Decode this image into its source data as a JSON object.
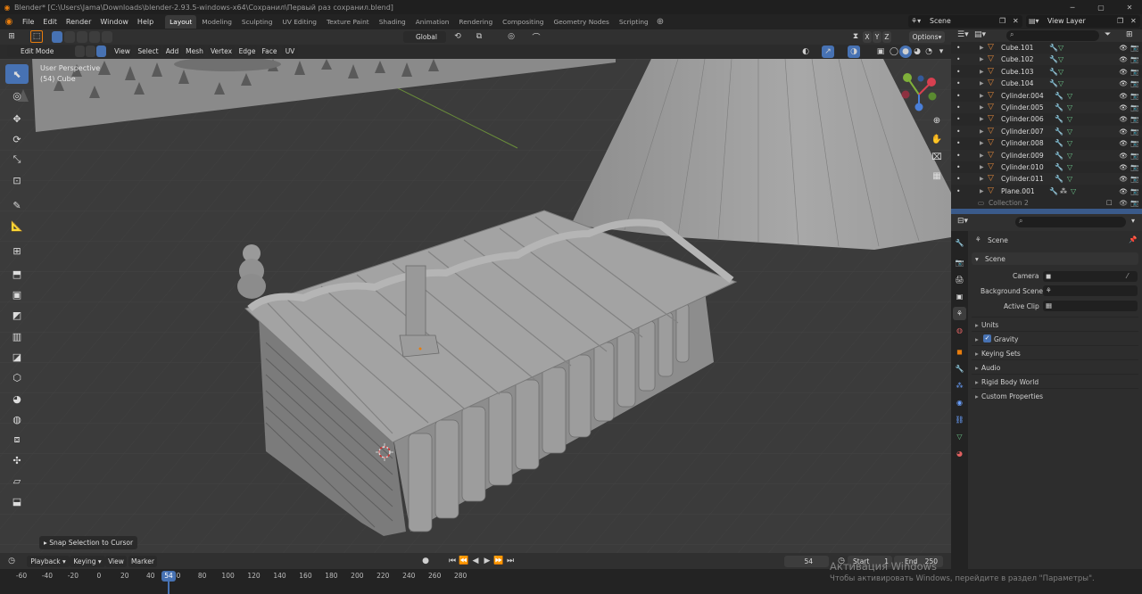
{
  "window": {
    "title": "Blender* [C:\\Users\\Jama\\Downloads\\blender-2.93.5-windows-x64\\Сохранил\\Первый раз сохранил.blend]"
  },
  "menu": [
    "File",
    "Edit",
    "Render",
    "Window",
    "Help"
  ],
  "workspaces": [
    "Layout",
    "Modeling",
    "Sculpting",
    "UV Editing",
    "Texture Paint",
    "Shading",
    "Animation",
    "Rendering",
    "Compositing",
    "Geometry Nodes",
    "Scripting"
  ],
  "active_workspace": "Layout",
  "scene_name": "Scene",
  "view_layer": "View Layer",
  "header": {
    "orientation": "Global",
    "axes": [
      "X",
      "Y",
      "Z"
    ],
    "options_label": "Options"
  },
  "edit_header": {
    "mode": "Edit Mode",
    "menus": [
      "View",
      "Select",
      "Add",
      "Mesh",
      "Vertex",
      "Edge",
      "Face",
      "UV"
    ]
  },
  "viewport": {
    "view_name": "User Perspective",
    "object_info": "(54) Cube",
    "last_op": "Snap Selection to Cursor"
  },
  "outliner": {
    "rows": [
      "Cube.101",
      "Cube.102",
      "Cube.103",
      "Cube.104",
      "Cylinder.004",
      "Cylinder.005",
      "Cylinder.006",
      "Cylinder.007",
      "Cylinder.008",
      "Cylinder.009",
      "Cylinder.010",
      "Cylinder.011",
      "Plane.001"
    ],
    "collection": "Collection 2"
  },
  "properties": {
    "context": "Scene",
    "panel": "Scene",
    "fields": [
      "Camera",
      "Background Scene",
      "Active Clip"
    ],
    "subpanels": [
      "Units",
      "Gravity",
      "Keying Sets",
      "Audio",
      "Rigid Body World",
      "Custom Properties"
    ],
    "gravity_checked": true
  },
  "timeline": {
    "menus": [
      "Playback",
      "Keying",
      "View",
      "Marker"
    ],
    "current_frame": "54",
    "start_label": "Start",
    "start": "1",
    "end_label": "End",
    "end": "250",
    "ticks": [
      "-60",
      "-40",
      "-20",
      "0",
      "20",
      "40",
      "60",
      "80",
      "100",
      "120",
      "140",
      "160",
      "180",
      "200",
      "220",
      "240",
      "260",
      "280"
    ]
  },
  "watermark": {
    "line1": "Активация Windows",
    "line2": "Чтобы активировать Windows, перейдите в раздел \"Параметры\"."
  },
  "colors": {
    "accent": "#4772b3",
    "object": "#e3883a",
    "modifier": "#76a6d8",
    "mesh_data": "#6cc48a",
    "frame": "#4772b3"
  }
}
